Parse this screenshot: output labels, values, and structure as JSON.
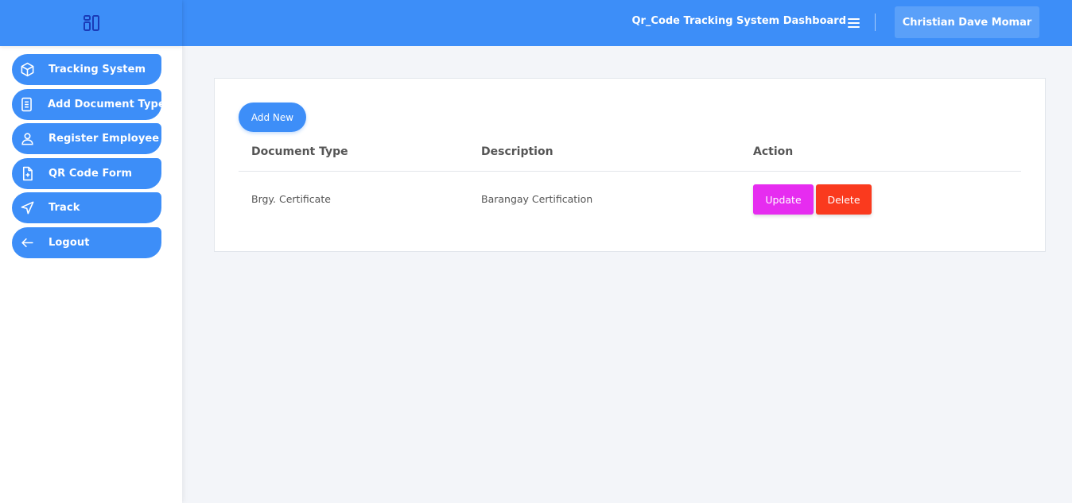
{
  "header": {
    "title": "Qr_Code Tracking System Dashboard",
    "user_name": "Christian Dave Momar"
  },
  "sidebar": {
    "items": [
      {
        "label": "Tracking System",
        "icon": "cube-icon"
      },
      {
        "label": "Add Document Type",
        "icon": "document-icon"
      },
      {
        "label": "Register Employee",
        "icon": "user-icon"
      },
      {
        "label": "QR Code Form",
        "icon": "file-plus-icon"
      },
      {
        "label": "Track",
        "icon": "navigation-icon"
      },
      {
        "label": "Logout",
        "icon": "arrow-left-icon"
      }
    ]
  },
  "main": {
    "add_button": "Add New",
    "table": {
      "headers": [
        "Document Type",
        "Description",
        "Action"
      ],
      "rows": [
        {
          "document_type": "Brgy. Certificate",
          "description": "Barangay Certification",
          "update_label": "Update",
          "delete_label": "Delete"
        }
      ]
    }
  },
  "colors": {
    "primary": "#3d8ef8",
    "update": "#e62cf0",
    "delete": "#fa3a1e",
    "background": "#f3f5f9"
  }
}
